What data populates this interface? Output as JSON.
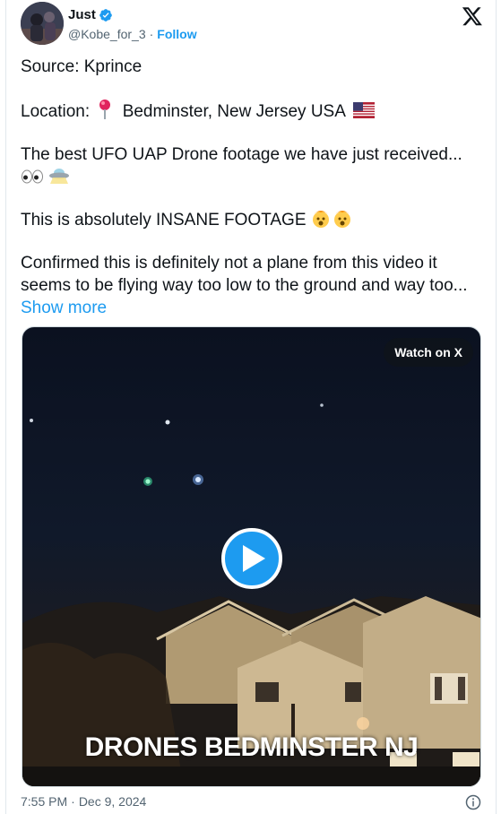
{
  "author": {
    "display_name": "Just",
    "handle": "@Kobe_for_3",
    "separator": "·",
    "follow_label": "Follow"
  },
  "tweet": {
    "source_line": "Source: Kprince",
    "location_label": "Location:",
    "location_value": "Bedminster, New Jersey USA",
    "line3": "The best UFO UAP Drone footage we have just received...",
    "line4": "This is absolutely INSANE FOOTAGE",
    "line5": "Confirmed this is definitely not a plane from this video it seems to be flying way too low to the ground and way too...",
    "show_more": "Show more"
  },
  "media": {
    "watch_label": "Watch on X",
    "caption": "DRONES BEDMINSTER NJ"
  },
  "footer": {
    "time": "7:55 PM",
    "separator": "·",
    "date": "Dec 9, 2024"
  },
  "colors": {
    "accent": "#1d9bf0",
    "secondary_text": "#536471"
  },
  "icons": [
    "verified-badge-icon",
    "x-logo-icon",
    "pushpin-icon",
    "us-flag-icon",
    "eyes-icon",
    "ufo-icon",
    "exploding-head-icon",
    "play-icon",
    "info-icon"
  ]
}
